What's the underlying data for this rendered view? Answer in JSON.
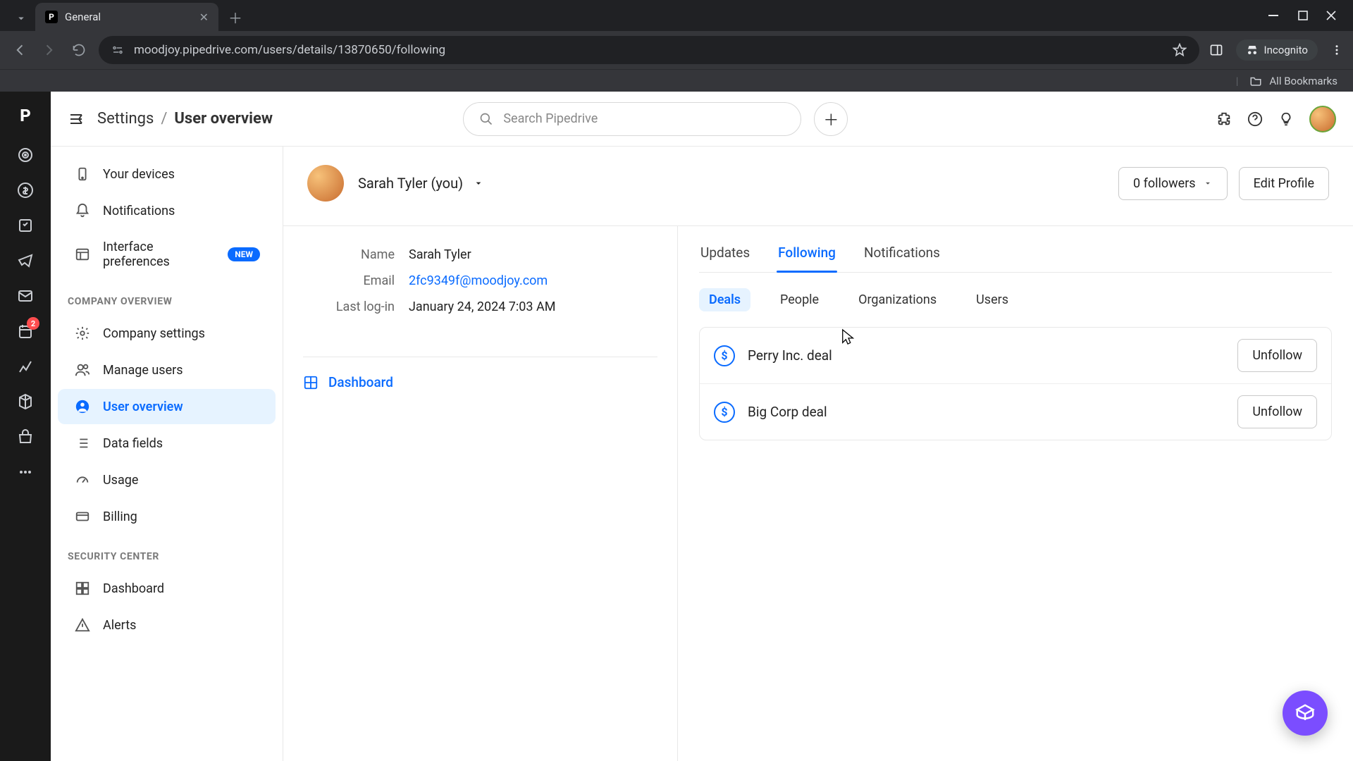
{
  "browser": {
    "tab_title": "General",
    "url": "moodjoy.pipedrive.com/users/details/13870650/following",
    "incognito_label": "Incognito",
    "all_bookmarks": "All Bookmarks"
  },
  "header": {
    "crumb_root": "Settings",
    "crumb_leaf": "User overview",
    "search_placeholder": "Search Pipedrive"
  },
  "rail": {
    "notification_badge": "2"
  },
  "sidebar": {
    "items_top": [
      {
        "label": "Your devices"
      },
      {
        "label": "Notifications"
      },
      {
        "label": "Interface preferences",
        "badge": "NEW"
      }
    ],
    "heading_company": "COMPANY OVERVIEW",
    "items_company": [
      {
        "label": "Company settings"
      },
      {
        "label": "Manage users"
      },
      {
        "label": "User overview",
        "active": true
      },
      {
        "label": "Data fields"
      },
      {
        "label": "Usage"
      },
      {
        "label": "Billing"
      }
    ],
    "heading_security": "SECURITY CENTER",
    "items_security": [
      {
        "label": "Dashboard"
      },
      {
        "label": "Alerts"
      }
    ]
  },
  "profile": {
    "display_name": "Sarah Tyler (you)",
    "followers_btn": "0 followers",
    "edit_btn": "Edit Profile"
  },
  "details": {
    "name_label": "Name",
    "name_value": "Sarah Tyler",
    "email_label": "Email",
    "email_value": "2fc9349f@moodjoy.com",
    "login_label": "Last log-in",
    "login_value": "January 24, 2024 7:03 AM",
    "dashboard_link": "Dashboard"
  },
  "tabs_primary": [
    "Updates",
    "Following",
    "Notifications"
  ],
  "tabs_primary_active": 1,
  "tabs_secondary": [
    "Deals",
    "People",
    "Organizations",
    "Users"
  ],
  "tabs_secondary_active": 0,
  "follow_items": [
    {
      "name": "Perry Inc. deal",
      "button": "Unfollow"
    },
    {
      "name": "Big Corp deal",
      "button": "Unfollow"
    }
  ]
}
